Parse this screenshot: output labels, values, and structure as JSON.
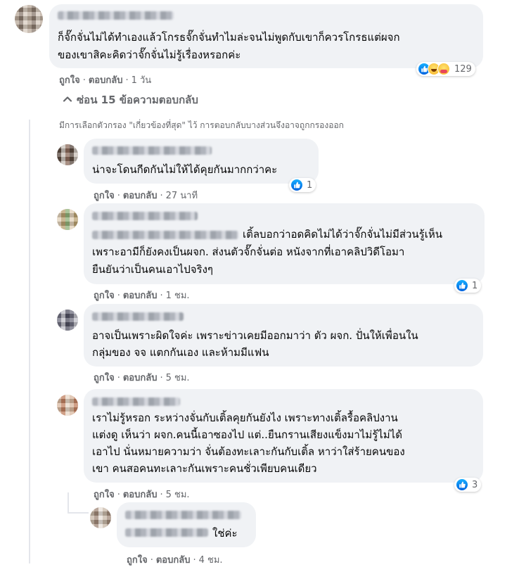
{
  "main_comment": {
    "line1": "ก็จั๊กจั่นไม่ได้ทำเองแล้วโกรธจั๊กจั่นทำไมล่ะจนไม่พูดกับเขาก็ควรโกรธแต่ผจก",
    "line2": "ของเขาสิคะคิดว่าจั๊กจั่นไม่รู้เรื่องหรอกค่ะ",
    "like_label": "ถูกใจ",
    "reply_label": "ตอบกลับ",
    "time": "1 วัน",
    "reaction_count": "129"
  },
  "hide_replies_label": "ซ่อน 15 ข้อความตอบกลับ",
  "filter_note": "มีการเลือกตัวกรอง \"เกี่ยวข้องที่สุด\" ไว้ การตอบกลับบางส่วนจึงอาจถูกกรองออก",
  "replies": [
    {
      "lines": [
        "น่าจะโดนกีดกันไม่ให้ได้คุยกันมากกว่าคะ"
      ],
      "like_label": "ถูกใจ",
      "reply_label": "ตอบกลับ",
      "time": "27 นาที",
      "reaction_count": "1"
    },
    {
      "lines": [
        "เติ้ลบอกว่าอดคิดไม่ได้ว่าจั๊กจั่นไม่มีส่วนรู้เห็น",
        "เพราะอามีก็ยังคงเป็นผจก. ส่งนตัวจั๊กจั่นต่อ หนังจากที่เอาคลิปวิดีโอมา",
        "ยืนยันว่าเป็นคนเอาไปจริงๆ"
      ],
      "like_label": "ถูกใจ",
      "reply_label": "ตอบกลับ",
      "time": "1 ชม.",
      "reaction_count": "1"
    },
    {
      "lines": [
        "อาจเป็นเพราะผิดใจค่ะ เพราะข่าวเคยมีออกมาว่า ตัว ผจก. ปั่นให้เพื่อนใน",
        "กลุ่มของ จจ แตกกันเอง และห้ามมีแฟน"
      ],
      "like_label": "ถูกใจ",
      "reply_label": "ตอบกลับ",
      "time": "5 ชม."
    },
    {
      "lines": [
        "เราไม่รู้หรอก ระหว่างจั่นกับเติ้ลคุยกันยังไง เพราะทางเติ้ลรื้อคลิปงาน",
        "แต่งดู เห็นว่า ผจก.คนนี้เอาซองไป แต่..ยืนกรานเสียงแข็งมาไม่รู้ไม่ได้",
        "เอาไป นั่นหมายความว่า จั่นต้องทะเลาะกันกับเติ้ล หาว่าใส่ร้ายคนของ",
        "เขา คนสอคนทะเลาะกันเพราะคนชั่วเพียบคนเดียว"
      ],
      "like_label": "ถูกใจ",
      "reply_label": "ตอบกลับ",
      "time": "5 ชม.",
      "reaction_count": "3"
    },
    {
      "lines": [
        "ใช่ค่ะ"
      ],
      "like_label": "ถูกใจ",
      "reply_label": "ตอบกลับ",
      "time": "4 ชม."
    }
  ],
  "icons": [
    "like-icon",
    "haha-icon",
    "care-icon",
    "chevron-up-icon",
    "avatar"
  ],
  "colors": {
    "bubble": "#f0f2f5",
    "meta_text": "#65676b",
    "like_blue": "#1877f2"
  }
}
